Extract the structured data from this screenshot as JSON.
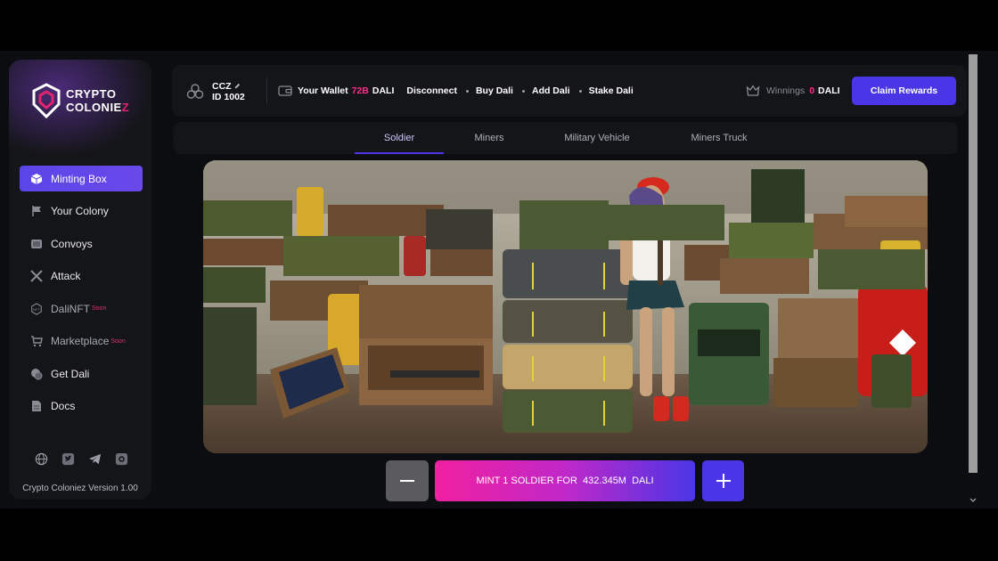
{
  "app": {
    "brand_line1": "CRYPTO",
    "brand_line2": "COLONIE",
    "brand_z": "Z",
    "version": "Crypto Coloniez Version 1.00"
  },
  "sidebar": {
    "items": [
      {
        "label": "Minting Box",
        "icon": "box-icon",
        "active": true
      },
      {
        "label": "Your Colony",
        "icon": "flag-icon"
      },
      {
        "label": "Convoys",
        "icon": "convoy-icon"
      },
      {
        "label": "Attack",
        "icon": "swords-icon"
      },
      {
        "label": "DaliNFT",
        "icon": "nft-icon",
        "badge": "Soon"
      },
      {
        "label": "Marketplace",
        "icon": "cart-icon",
        "badge": "Soon"
      },
      {
        "label": "Get Dali",
        "icon": "coins-icon"
      },
      {
        "label": "Docs",
        "icon": "document-icon"
      }
    ],
    "socials": [
      "globe-icon",
      "twitter-icon",
      "telegram-icon",
      "discord-icon"
    ]
  },
  "header": {
    "ticker": "CCZ",
    "user_id": "ID 1002",
    "wallet_label": "Your Wallet",
    "wallet_amount": "72B",
    "wallet_currency": "DALI",
    "disconnect": "Disconnect",
    "buy": "Buy Dali",
    "add": "Add Dali",
    "stake": "Stake Dali",
    "winnings_label": "Winnings",
    "winnings_amount": "0",
    "winnings_currency": "DALI",
    "claim": "Claim Rewards"
  },
  "tabs": [
    {
      "label": "Soldier",
      "active": true
    },
    {
      "label": "Miners"
    },
    {
      "label": "Military Vehicle"
    },
    {
      "label": "Miners Truck"
    }
  ],
  "mint": {
    "label": "MINT 1 SOLDIER FOR  432.345M  DALI",
    "minus": "−",
    "plus": "+"
  },
  "colors": {
    "accent": "#4a36e6",
    "pink": "#ff2e8d",
    "bg": "#0c0d10",
    "panel": "#141518"
  }
}
